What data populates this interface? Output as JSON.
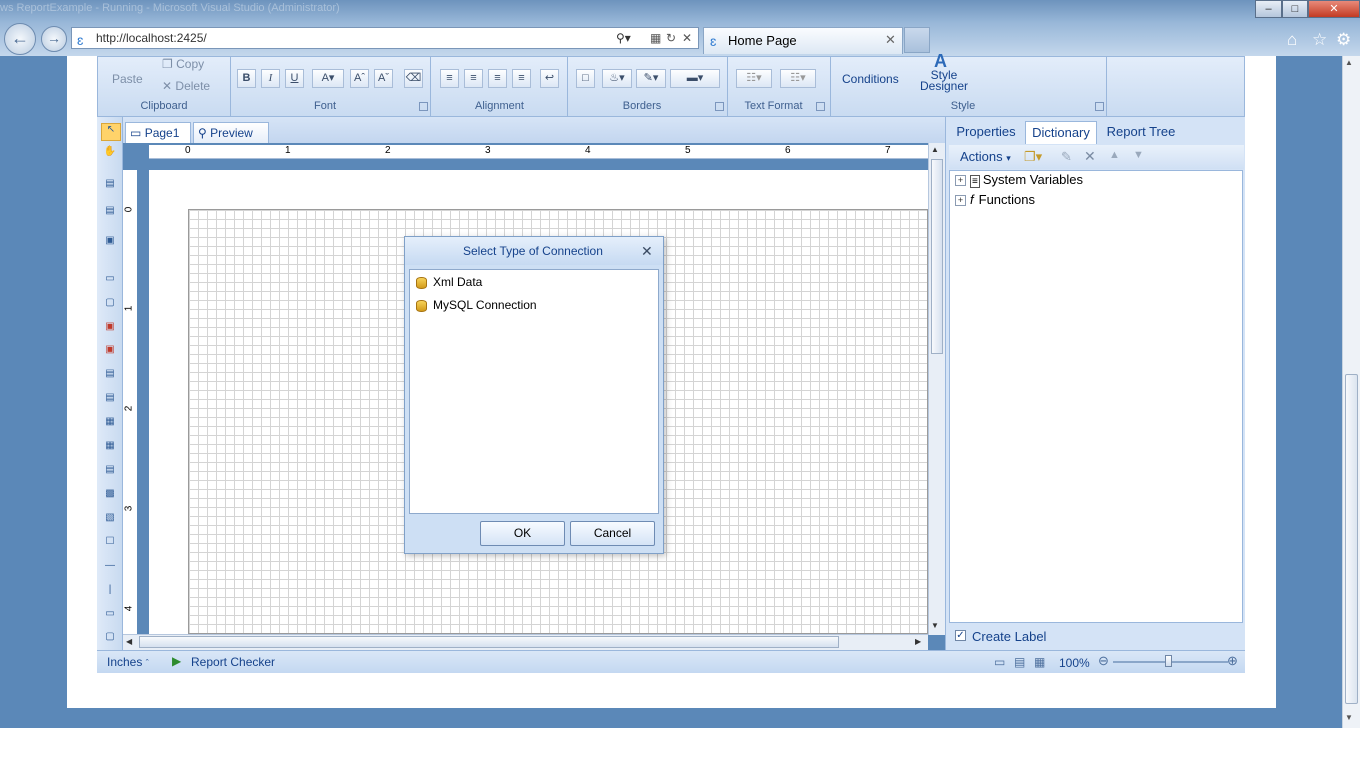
{
  "browser": {
    "window_title": "ws ReportExample - Running - Microsoft Visual Studio (Administrator)",
    "url": "http://localhost:2425/",
    "tab_title": "Home Page",
    "icons": [
      "back-icon",
      "forward-icon",
      "ie-logo-icon",
      "search-icon",
      "compat-icon",
      "refresh-icon",
      "stop-icon",
      "home-icon",
      "favorites-icon",
      "tools-icon"
    ]
  },
  "ribbon": {
    "clipboard": {
      "label": "Clipboard",
      "paste": "Paste",
      "copy": "Copy",
      "delete": "Delete"
    },
    "font": {
      "label": "Font",
      "bold": "B",
      "italic": "I",
      "underline": "U"
    },
    "alignment": {
      "label": "Alignment"
    },
    "borders": {
      "label": "Borders"
    },
    "text_format": {
      "label": "Text Format"
    },
    "style": {
      "label": "Style",
      "conditions": "Conditions",
      "style_designer": "Style Designer"
    }
  },
  "designer": {
    "tabs": [
      "Page1",
      "Preview"
    ],
    "ruler_h": [
      "0",
      "1",
      "2",
      "3",
      "4",
      "5",
      "6",
      "7"
    ],
    "ruler_v": [
      "0",
      "1",
      "2",
      "3",
      "4"
    ]
  },
  "right_panel": {
    "tabs": [
      "Properties",
      "Dictionary",
      "Report Tree"
    ],
    "active_tab": "Dictionary",
    "actions_label": "Actions",
    "tree": [
      "System Variables",
      "Functions"
    ],
    "create_label": "Create Label",
    "create_label_checked": true
  },
  "status": {
    "units": "Inches",
    "report_checker": "Report Checker",
    "zoom": "100%"
  },
  "dialog": {
    "title": "Select Type of Connection",
    "items": [
      "Xml Data",
      "MySQL Connection"
    ],
    "ok": "OK",
    "cancel": "Cancel"
  },
  "colors": {
    "accent": "#15428b",
    "page_bg": "#5b88b8",
    "ribbon": "#c9dbf1"
  }
}
